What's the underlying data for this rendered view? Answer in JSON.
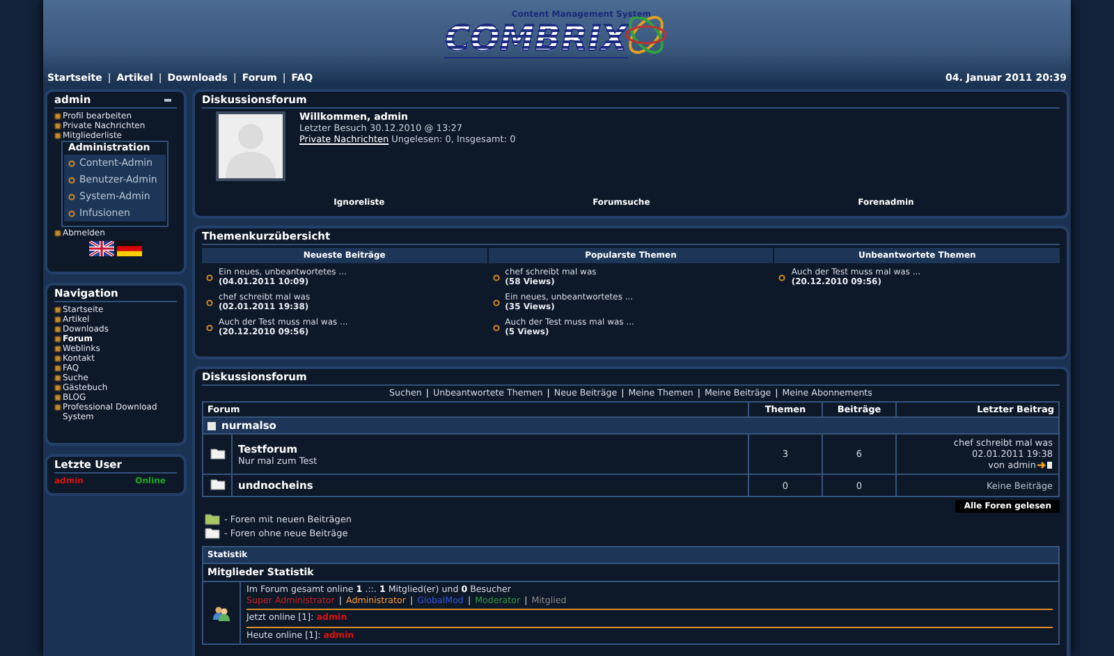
{
  "header": {
    "logo_text": "COMBRIX",
    "logo_tagline": "Content Management System"
  },
  "top_nav": {
    "separator": "|",
    "items": [
      "Startseite",
      "Artikel",
      "Downloads",
      "Forum",
      "FAQ"
    ],
    "date": "04. Januar 2011 20:39"
  },
  "user_panel": {
    "title": "admin",
    "links": [
      "Profil bearbeiten",
      "Private Nachrichten",
      "Mitgliederliste"
    ],
    "admin_box": {
      "title": "Administration",
      "items": [
        "Content-Admin",
        "Benutzer-Admin",
        "System-Admin",
        "Infusionen"
      ]
    },
    "logout": "Abmelden"
  },
  "navigation": {
    "title": "Navigation",
    "items": [
      {
        "label": "Startseite",
        "selected": false
      },
      {
        "label": "Artikel",
        "selected": false
      },
      {
        "label": "Downloads",
        "selected": false
      },
      {
        "label": "Forum",
        "selected": true
      },
      {
        "label": "Weblinks",
        "selected": false
      },
      {
        "label": "Kontakt",
        "selected": false
      },
      {
        "label": "FAQ",
        "selected": false
      },
      {
        "label": "Suche",
        "selected": false
      },
      {
        "label": "Gästebuch",
        "selected": false
      },
      {
        "label": "BLOG",
        "selected": false
      },
      {
        "label": "Professional Download System",
        "selected": false
      }
    ]
  },
  "last_users": {
    "title": "Letzte User",
    "rows": [
      {
        "name": "admin",
        "status": "Online"
      }
    ]
  },
  "welcome": {
    "title": "Diskussionsforum",
    "greeting": "Willkommen, admin",
    "last_visit": "Letzter Besuch 30.12.2010 @ 13:27",
    "pm_link": "Private Nachrichten",
    "pm_text": "Ungelesen: 0, Insgesamt: 0",
    "links": [
      "Ignoreliste",
      "Forumsuche",
      "Forenadmin"
    ]
  },
  "overview": {
    "title": "Themenkurzübersicht",
    "columns": [
      {
        "heading": "Neueste Beiträge",
        "items": [
          {
            "title": "Ein neues, unbeantwortetes ...",
            "meta": "(04.01.2011 10:09)"
          },
          {
            "title": "chef schreibt mal was",
            "meta": "(02.01.2011 19:38)"
          },
          {
            "title": "Auch der Test muss mal was ...",
            "meta": "(20.12.2010 09:56)"
          }
        ]
      },
      {
        "heading": "Popularste Themen",
        "items": [
          {
            "title": "chef schreibt mal was",
            "meta": "(58 Views)"
          },
          {
            "title": "Ein neues, unbeantwortetes ...",
            "meta": "(35 Views)"
          },
          {
            "title": "Auch der Test muss mal was ...",
            "meta": "(5 Views)"
          }
        ]
      },
      {
        "heading": "Unbeantwortete Themen",
        "items": [
          {
            "title": "Auch der Test muss mal was ...",
            "meta": "(20.12.2010 09:56)"
          }
        ]
      }
    ]
  },
  "forum": {
    "title": "Diskussionsforum",
    "separator": "|",
    "links": [
      "Suchen",
      "Unbeantwortete Themen",
      "Neue Beiträge",
      "Meine Themen",
      "Meine Beiträge",
      "Meine Abonnements"
    ],
    "columns": [
      "Forum",
      "Themen",
      "Beiträge",
      "Letzter Beitrag"
    ],
    "category": "nurmalso",
    "rows": [
      {
        "name": "Testforum",
        "description": "Nur mal zum Test",
        "topics": "3",
        "posts": "6",
        "last_post": {
          "kind": "post",
          "title": "chef schreibt mal was",
          "date": "02.01.2011 19:38",
          "by": "von admin"
        }
      },
      {
        "name": "undnocheins",
        "topics": "0",
        "posts": "0",
        "last_post": {
          "kind": "none",
          "title": "Keine Beiträge"
        }
      }
    ],
    "mark_read": "Alle Foren gelesen",
    "legend": [
      {
        "kind": "new",
        "label": "- Foren mit neuen Beiträgen"
      },
      {
        "kind": "none",
        "label": "- Foren ohne neue Beiträge"
      }
    ]
  },
  "stats": {
    "header": "Statistik",
    "separator": "|",
    "subheader": "Mitglieder Statistik",
    "online_line": "Im Forum gesamt online **1** .::. **1** Mitglied(er) und **0** Besucher",
    "groups": [
      {
        "label": "Super Administrator",
        "color": "#cc2222"
      },
      {
        "label": "Administrator",
        "color": "#ff9933"
      },
      {
        "label": "GlobalMod",
        "color": "#3355dd"
      },
      {
        "label": "Moderator",
        "color": "#339944"
      },
      {
        "label": "Mitglied",
        "color": "#888888"
      }
    ],
    "now_online": {
      "label": "Jetzt online [1]:",
      "user": "admin"
    },
    "today_online": {
      "label": "Heute online [1]:",
      "user": "admin"
    }
  }
}
